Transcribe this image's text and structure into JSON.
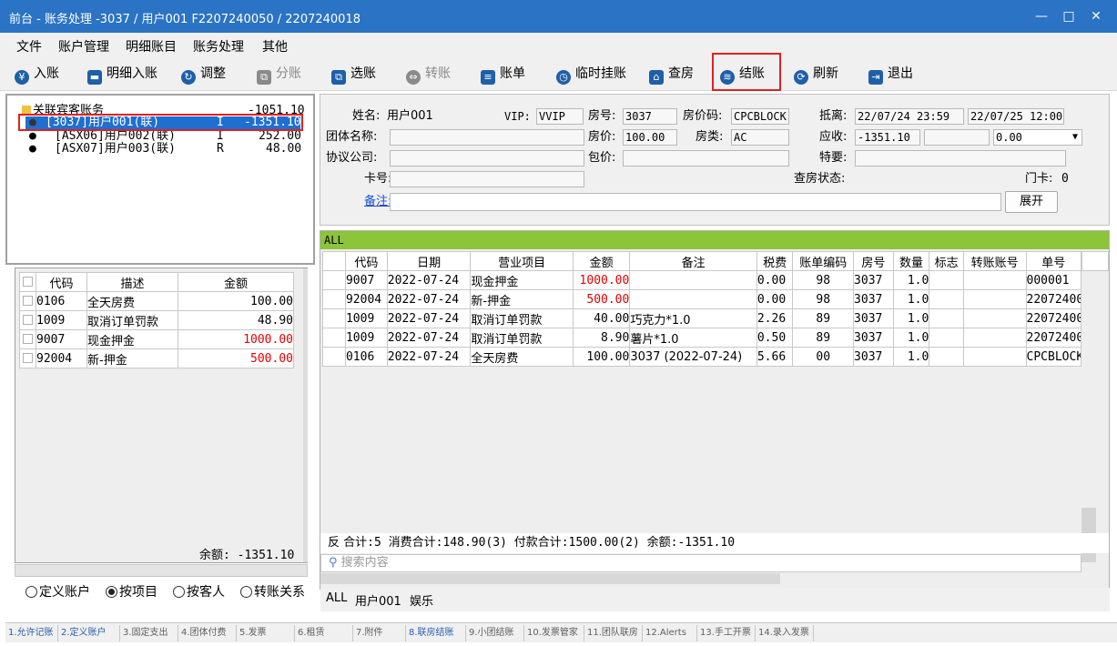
{
  "window": {
    "title": "前台 - 账务处理 -3037 / 用户001 F2207240050 / 2207240018",
    "controls": [
      "—",
      "□",
      "✕"
    ]
  },
  "menu": [
    "文件",
    "账户管理",
    "明细账目",
    "账务处理",
    "其他"
  ],
  "toolbar": [
    {
      "label": "入账",
      "icon": "yen-circle-icon",
      "glyph": "¥",
      "color": "#1e5fa8",
      "enabled": true
    },
    {
      "label": "明细入账",
      "icon": "card-icon",
      "glyph": "▬",
      "color": "#1e5fa8",
      "enabled": true
    },
    {
      "label": "调整",
      "icon": "adjust-icon",
      "glyph": "↻",
      "color": "#1e5fa8",
      "enabled": true
    },
    {
      "label": "分账",
      "icon": "split-icon",
      "glyph": "⧉",
      "color": "#8a8a8a",
      "enabled": false
    },
    {
      "label": "选账",
      "icon": "select-bill-icon",
      "glyph": "⧉",
      "color": "#1e5fa8",
      "enabled": true
    },
    {
      "label": "转账",
      "icon": "transfer-icon",
      "glyph": "⇔",
      "color": "#8a8a8a",
      "enabled": false
    },
    {
      "label": "账单",
      "icon": "bill-icon",
      "glyph": "≡",
      "color": "#1e5fa8",
      "enabled": true
    },
    {
      "label": "临时挂账",
      "icon": "clock-icon",
      "glyph": "◷",
      "color": "#1e5fa8",
      "enabled": true
    },
    {
      "label": "查房",
      "icon": "house-icon",
      "glyph": "⌂",
      "color": "#1e5fa8",
      "enabled": true
    },
    {
      "label": "结账",
      "icon": "coins-icon",
      "glyph": "≋",
      "color": "#1e5fa8",
      "enabled": true
    },
    {
      "label": "刷新",
      "icon": "refresh-icon",
      "glyph": "⟳",
      "color": "#1e5fa8",
      "enabled": true
    },
    {
      "label": "退出",
      "icon": "exit-icon",
      "glyph": "⇥",
      "color": "#1e5fa8",
      "enabled": true
    }
  ],
  "tree": {
    "root": {
      "label": "关联宾客账务",
      "amount": "-1051.10"
    },
    "children": [
      {
        "label": "[3037]用户001(联)",
        "type": "I",
        "amount": "-1351.10",
        "selected": true
      },
      {
        "label": "[ASX06]用户002(联)",
        "type": "I",
        "amount": "252.00",
        "selected": false
      },
      {
        "label": "[ASX07]用户003(联)",
        "type": "R",
        "amount": "48.00",
        "selected": false
      }
    ]
  },
  "items_table": {
    "headers": [
      "代码",
      "描述",
      "金额"
    ],
    "rows": [
      {
        "code": "0106",
        "desc": "全天房费",
        "amount": "100.00",
        "red": false
      },
      {
        "code": "1009",
        "desc": "取消订单罚款",
        "amount": "48.90",
        "red": false
      },
      {
        "code": "9007",
        "desc": "现金押金",
        "amount": "1000.00",
        "red": true
      },
      {
        "code": "92004",
        "desc": "新-押金",
        "amount": "500.00",
        "red": true
      }
    ],
    "balance": "余额: -1351.10"
  },
  "radio_options": [
    {
      "label": "定义账户",
      "checked": false
    },
    {
      "label": "按项目",
      "checked": true
    },
    {
      "label": "按客人",
      "checked": false
    },
    {
      "label": "转账关系",
      "checked": false
    }
  ],
  "guest": {
    "name_label": "姓名:",
    "name": "用户001",
    "vip_label": "VIP:",
    "vip": "VVIP",
    "room_label": "房号:",
    "room": "3037",
    "rate_code_label": "房价码:",
    "rate_code": "CPCBLOCK",
    "arrive_label": "抵离:",
    "arrive": "22/07/24 23:59",
    "depart": "22/07/25 12:00",
    "group_label": "团体名称:",
    "group": "",
    "price_label": "房价:",
    "price": "100.00",
    "room_type_label": "房类:",
    "room_type": "AC",
    "receivable_label": "应收:",
    "receivable": "-1351.10",
    "receivable_extra": "",
    "receivable_select": "0.00",
    "company_label": "协议公司:",
    "company": "",
    "package_label": "包价:",
    "package": "",
    "special_label": "特要:",
    "special": "",
    "card_label": "卡号:",
    "card": "",
    "check_status_label": "查房状态:",
    "door_card_label": "门卡:",
    "door_card": "0",
    "remark_label": "备注:",
    "remark": "",
    "expand_label": "展开"
  },
  "grid": {
    "group_label": "ALL",
    "headers": [
      "代码",
      "日期",
      "营业项目",
      "金额",
      "备注",
      "税费",
      "账单编码",
      "房号",
      "数量",
      "标志",
      "转账账号",
      "单号"
    ],
    "rows": [
      {
        "code": "9007",
        "date": "2022-07-24",
        "item": "现金押金",
        "amount": "1000.00",
        "red": true,
        "remark": "",
        "tax": "0.00",
        "bill": "98",
        "room": "3037",
        "qty": "1.0",
        "flag": "",
        "transfer": "",
        "no": "000001"
      },
      {
        "code": "92004",
        "date": "2022-07-24",
        "item": "新-押金",
        "amount": "500.00",
        "red": true,
        "remark": "",
        "tax": "0.00",
        "bill": "98",
        "room": "3037",
        "qty": "1.0",
        "flag": "",
        "transfer": "",
        "no": "22072400"
      },
      {
        "code": "1009",
        "date": "2022-07-24",
        "item": "取消订单罚款",
        "amount": "40.00",
        "red": false,
        "remark": "巧克力*1.0",
        "tax": "2.26",
        "bill": "89",
        "room": "3037",
        "qty": "1.0",
        "flag": "",
        "transfer": "",
        "no": "22072400"
      },
      {
        "code": "1009",
        "date": "2022-07-24",
        "item": "取消订单罚款",
        "amount": "8.90",
        "red": false,
        "remark": "薯片*1.0",
        "tax": "0.50",
        "bill": "89",
        "room": "3037",
        "qty": "1.0",
        "flag": "",
        "transfer": "",
        "no": "22072400"
      },
      {
        "code": "0106",
        "date": "2022-07-24",
        "item": "全天房费",
        "amount": "100.00",
        "red": false,
        "remark": "3037 (2022-07-24)",
        "tax": "5.66",
        "bill": "00",
        "room": "3037",
        "qty": "1.0",
        "flag": "",
        "transfer": "",
        "no": "CPCBLOCK"
      }
    ],
    "reverse_label": "反",
    "summary": "合计:5  消费合计:148.90(3)  付款合计:1500.00(2)  余额:-1351.10",
    "search_placeholder": "搜索内容",
    "bottom_tabs": [
      "ALL",
      "用户001",
      "娱乐"
    ]
  },
  "status_tabs": [
    {
      "label": "1.允许记账",
      "blue": true
    },
    {
      "label": "2.定义账户",
      "blue": true
    },
    {
      "label": "3.固定支出",
      "blue": false
    },
    {
      "label": "4.团体付费",
      "blue": false
    },
    {
      "label": "5.发票",
      "blue": false
    },
    {
      "label": "6.租赁",
      "blue": false
    },
    {
      "label": "7.附件",
      "blue": false
    },
    {
      "label": "8.联房结账",
      "blue": true
    },
    {
      "label": "9.小团结账",
      "blue": false
    },
    {
      "label": "10.发票管家",
      "blue": false
    },
    {
      "label": "11.团队联房",
      "blue": false
    },
    {
      "label": "12.Alerts",
      "blue": false
    },
    {
      "label": "13.手工开票",
      "blue": false
    },
    {
      "label": "14.录入发票",
      "blue": false
    }
  ],
  "colors": {
    "titlebar": "#2b73c4",
    "highlight": "#e02020",
    "group_bar": "#8cc43a",
    "selection": "#1e6fd0"
  }
}
